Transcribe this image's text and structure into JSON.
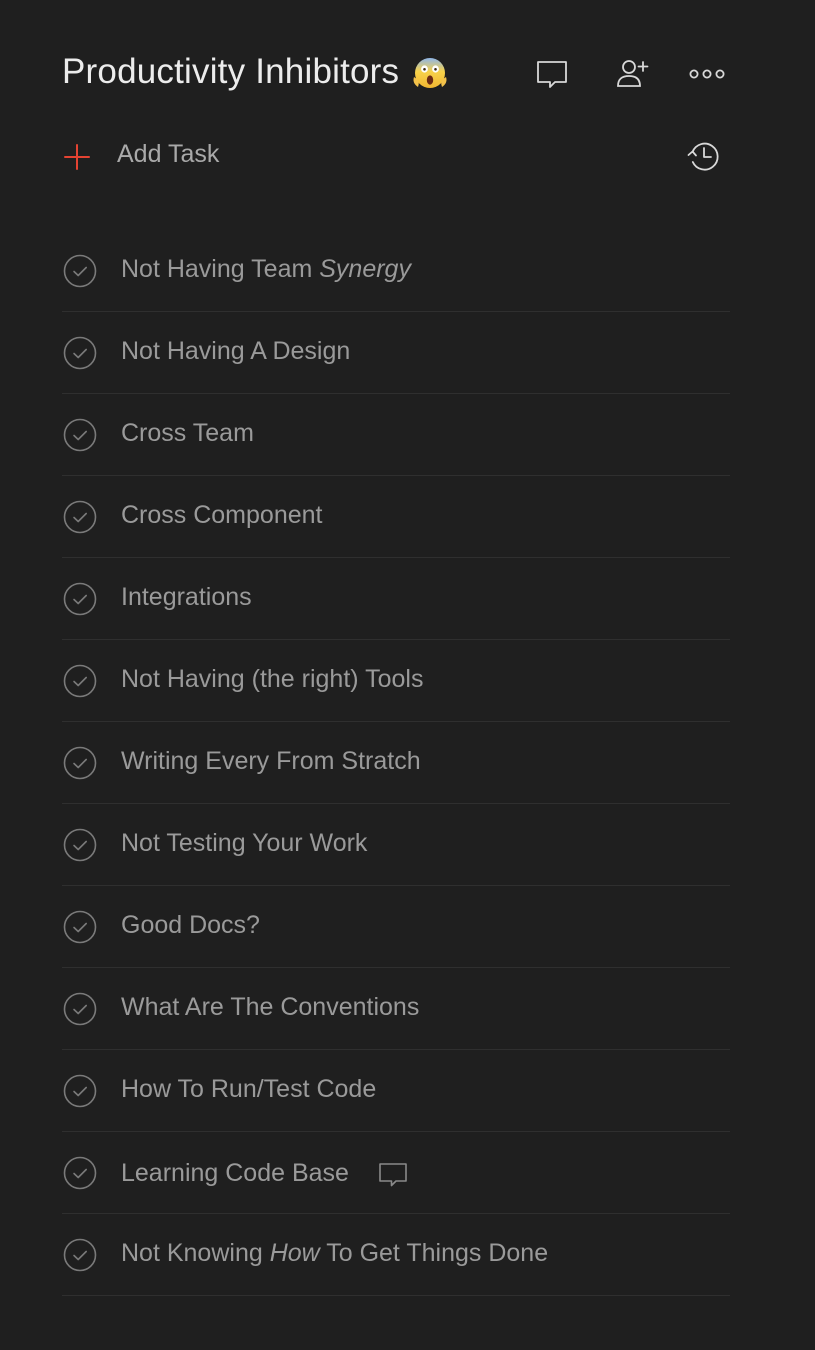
{
  "project": {
    "title": "Productivity Inhibitors",
    "emoji": "scream-emoji"
  },
  "header_icons": [
    "comment-icon",
    "add-person-icon",
    "more-icon"
  ],
  "add_task": {
    "label": "Add Task",
    "icon": "plus-icon",
    "accent": "#e44332"
  },
  "history_icon": "history-icon",
  "tasks": [
    {
      "pre": "Not Having Team ",
      "em": "Synergy",
      "post": "",
      "comment": false
    },
    {
      "pre": "Not Having A Design",
      "em": "",
      "post": "",
      "comment": false
    },
    {
      "pre": "Cross Team",
      "em": "",
      "post": "",
      "comment": false
    },
    {
      "pre": "Cross Component",
      "em": "",
      "post": "",
      "comment": false
    },
    {
      "pre": "Integrations",
      "em": "",
      "post": "",
      "comment": false
    },
    {
      "pre": "Not Having (the right) Tools",
      "em": "",
      "post": "",
      "comment": false
    },
    {
      "pre": "Writing Every From Stratch",
      "em": "",
      "post": "",
      "comment": false
    },
    {
      "pre": "Not Testing Your Work",
      "em": "",
      "post": "",
      "comment": false
    },
    {
      "pre": "Good Docs?",
      "em": "",
      "post": "",
      "comment": false
    },
    {
      "pre": "What Are The Conventions",
      "em": "",
      "post": "",
      "comment": false
    },
    {
      "pre": "How To Run/Test Code",
      "em": "",
      "post": "",
      "comment": false
    },
    {
      "pre": "Learning Code Base",
      "em": "",
      "post": "",
      "comment": true
    },
    {
      "pre": "Not Knowing ",
      "em": "How",
      "post": " To Get Things Done",
      "comment": false
    }
  ],
  "colors": {
    "background": "#1f1f1f",
    "task_text": "#9a9a9a",
    "divider": "#2f2f2f",
    "icon": "#d8d8d8",
    "check": "#7a7a7a"
  }
}
